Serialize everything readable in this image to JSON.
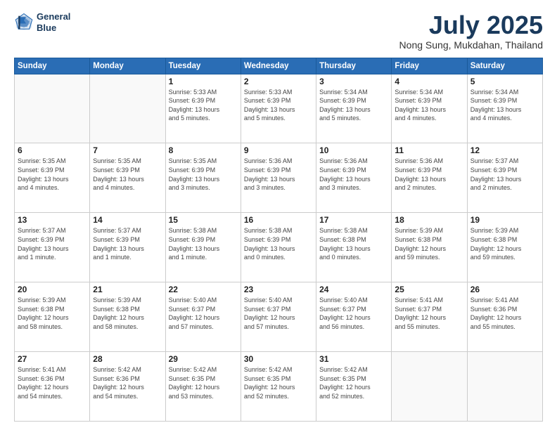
{
  "header": {
    "logo_line1": "General",
    "logo_line2": "Blue",
    "month_title": "July 2025",
    "subtitle": "Nong Sung, Mukdahan, Thailand"
  },
  "weekdays": [
    "Sunday",
    "Monday",
    "Tuesday",
    "Wednesday",
    "Thursday",
    "Friday",
    "Saturday"
  ],
  "weeks": [
    [
      {
        "day": "",
        "info": ""
      },
      {
        "day": "",
        "info": ""
      },
      {
        "day": "1",
        "info": "Sunrise: 5:33 AM\nSunset: 6:39 PM\nDaylight: 13 hours\nand 5 minutes."
      },
      {
        "day": "2",
        "info": "Sunrise: 5:33 AM\nSunset: 6:39 PM\nDaylight: 13 hours\nand 5 minutes."
      },
      {
        "day": "3",
        "info": "Sunrise: 5:34 AM\nSunset: 6:39 PM\nDaylight: 13 hours\nand 5 minutes."
      },
      {
        "day": "4",
        "info": "Sunrise: 5:34 AM\nSunset: 6:39 PM\nDaylight: 13 hours\nand 4 minutes."
      },
      {
        "day": "5",
        "info": "Sunrise: 5:34 AM\nSunset: 6:39 PM\nDaylight: 13 hours\nand 4 minutes."
      }
    ],
    [
      {
        "day": "6",
        "info": "Sunrise: 5:35 AM\nSunset: 6:39 PM\nDaylight: 13 hours\nand 4 minutes."
      },
      {
        "day": "7",
        "info": "Sunrise: 5:35 AM\nSunset: 6:39 PM\nDaylight: 13 hours\nand 4 minutes."
      },
      {
        "day": "8",
        "info": "Sunrise: 5:35 AM\nSunset: 6:39 PM\nDaylight: 13 hours\nand 3 minutes."
      },
      {
        "day": "9",
        "info": "Sunrise: 5:36 AM\nSunset: 6:39 PM\nDaylight: 13 hours\nand 3 minutes."
      },
      {
        "day": "10",
        "info": "Sunrise: 5:36 AM\nSunset: 6:39 PM\nDaylight: 13 hours\nand 3 minutes."
      },
      {
        "day": "11",
        "info": "Sunrise: 5:36 AM\nSunset: 6:39 PM\nDaylight: 13 hours\nand 2 minutes."
      },
      {
        "day": "12",
        "info": "Sunrise: 5:37 AM\nSunset: 6:39 PM\nDaylight: 13 hours\nand 2 minutes."
      }
    ],
    [
      {
        "day": "13",
        "info": "Sunrise: 5:37 AM\nSunset: 6:39 PM\nDaylight: 13 hours\nand 1 minute."
      },
      {
        "day": "14",
        "info": "Sunrise: 5:37 AM\nSunset: 6:39 PM\nDaylight: 13 hours\nand 1 minute."
      },
      {
        "day": "15",
        "info": "Sunrise: 5:38 AM\nSunset: 6:39 PM\nDaylight: 13 hours\nand 1 minute."
      },
      {
        "day": "16",
        "info": "Sunrise: 5:38 AM\nSunset: 6:39 PM\nDaylight: 13 hours\nand 0 minutes."
      },
      {
        "day": "17",
        "info": "Sunrise: 5:38 AM\nSunset: 6:38 PM\nDaylight: 13 hours\nand 0 minutes."
      },
      {
        "day": "18",
        "info": "Sunrise: 5:39 AM\nSunset: 6:38 PM\nDaylight: 12 hours\nand 59 minutes."
      },
      {
        "day": "19",
        "info": "Sunrise: 5:39 AM\nSunset: 6:38 PM\nDaylight: 12 hours\nand 59 minutes."
      }
    ],
    [
      {
        "day": "20",
        "info": "Sunrise: 5:39 AM\nSunset: 6:38 PM\nDaylight: 12 hours\nand 58 minutes."
      },
      {
        "day": "21",
        "info": "Sunrise: 5:39 AM\nSunset: 6:38 PM\nDaylight: 12 hours\nand 58 minutes."
      },
      {
        "day": "22",
        "info": "Sunrise: 5:40 AM\nSunset: 6:37 PM\nDaylight: 12 hours\nand 57 minutes."
      },
      {
        "day": "23",
        "info": "Sunrise: 5:40 AM\nSunset: 6:37 PM\nDaylight: 12 hours\nand 57 minutes."
      },
      {
        "day": "24",
        "info": "Sunrise: 5:40 AM\nSunset: 6:37 PM\nDaylight: 12 hours\nand 56 minutes."
      },
      {
        "day": "25",
        "info": "Sunrise: 5:41 AM\nSunset: 6:37 PM\nDaylight: 12 hours\nand 55 minutes."
      },
      {
        "day": "26",
        "info": "Sunrise: 5:41 AM\nSunset: 6:36 PM\nDaylight: 12 hours\nand 55 minutes."
      }
    ],
    [
      {
        "day": "27",
        "info": "Sunrise: 5:41 AM\nSunset: 6:36 PM\nDaylight: 12 hours\nand 54 minutes."
      },
      {
        "day": "28",
        "info": "Sunrise: 5:42 AM\nSunset: 6:36 PM\nDaylight: 12 hours\nand 54 minutes."
      },
      {
        "day": "29",
        "info": "Sunrise: 5:42 AM\nSunset: 6:35 PM\nDaylight: 12 hours\nand 53 minutes."
      },
      {
        "day": "30",
        "info": "Sunrise: 5:42 AM\nSunset: 6:35 PM\nDaylight: 12 hours\nand 52 minutes."
      },
      {
        "day": "31",
        "info": "Sunrise: 5:42 AM\nSunset: 6:35 PM\nDaylight: 12 hours\nand 52 minutes."
      },
      {
        "day": "",
        "info": ""
      },
      {
        "day": "",
        "info": ""
      }
    ]
  ]
}
